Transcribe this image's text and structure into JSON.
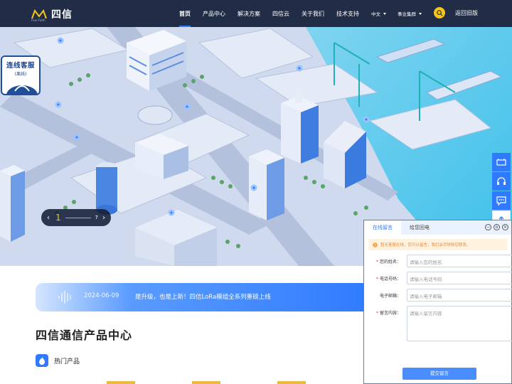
{
  "header": {
    "logo_text": "四信",
    "logo_sub": "Four-Faith",
    "nav": [
      "首页",
      "产品中心",
      "解决方案",
      "四信云",
      "关于我们",
      "技术支持"
    ],
    "lang": "中文",
    "group": "事业集群",
    "old_site": "返回旧版"
  },
  "service": {
    "title": "连线客服",
    "status": "(离线)"
  },
  "pager": {
    "current": "1",
    "total": "7"
  },
  "news": {
    "date": "2024-06-09",
    "text": "是升级，也是上新！四信LoRa模组全系列重磅上线"
  },
  "product": {
    "title": "四信通信产品中心",
    "hot": "热门产品"
  },
  "message": {
    "tab_active": "在线留言",
    "tab_other": "给您回电",
    "notice": "暂无客服在线，您可以留言，我们会尽快和您联系。",
    "fields": [
      {
        "label": "您的姓名",
        "required": true,
        "placeholder": "请输入您的姓名"
      },
      {
        "label": "电话号码",
        "required": true,
        "placeholder": "请输入电话号码"
      },
      {
        "label": "电子邮箱",
        "required": false,
        "placeholder": "请输入电子邮箱"
      },
      {
        "label": "留言内容",
        "required": true,
        "placeholder": "请输入留言内容"
      }
    ],
    "submit": "提交留言"
  },
  "colors": {
    "accent": "#2f7bff",
    "header_bg": "#121e38",
    "search": "#f5c518"
  }
}
